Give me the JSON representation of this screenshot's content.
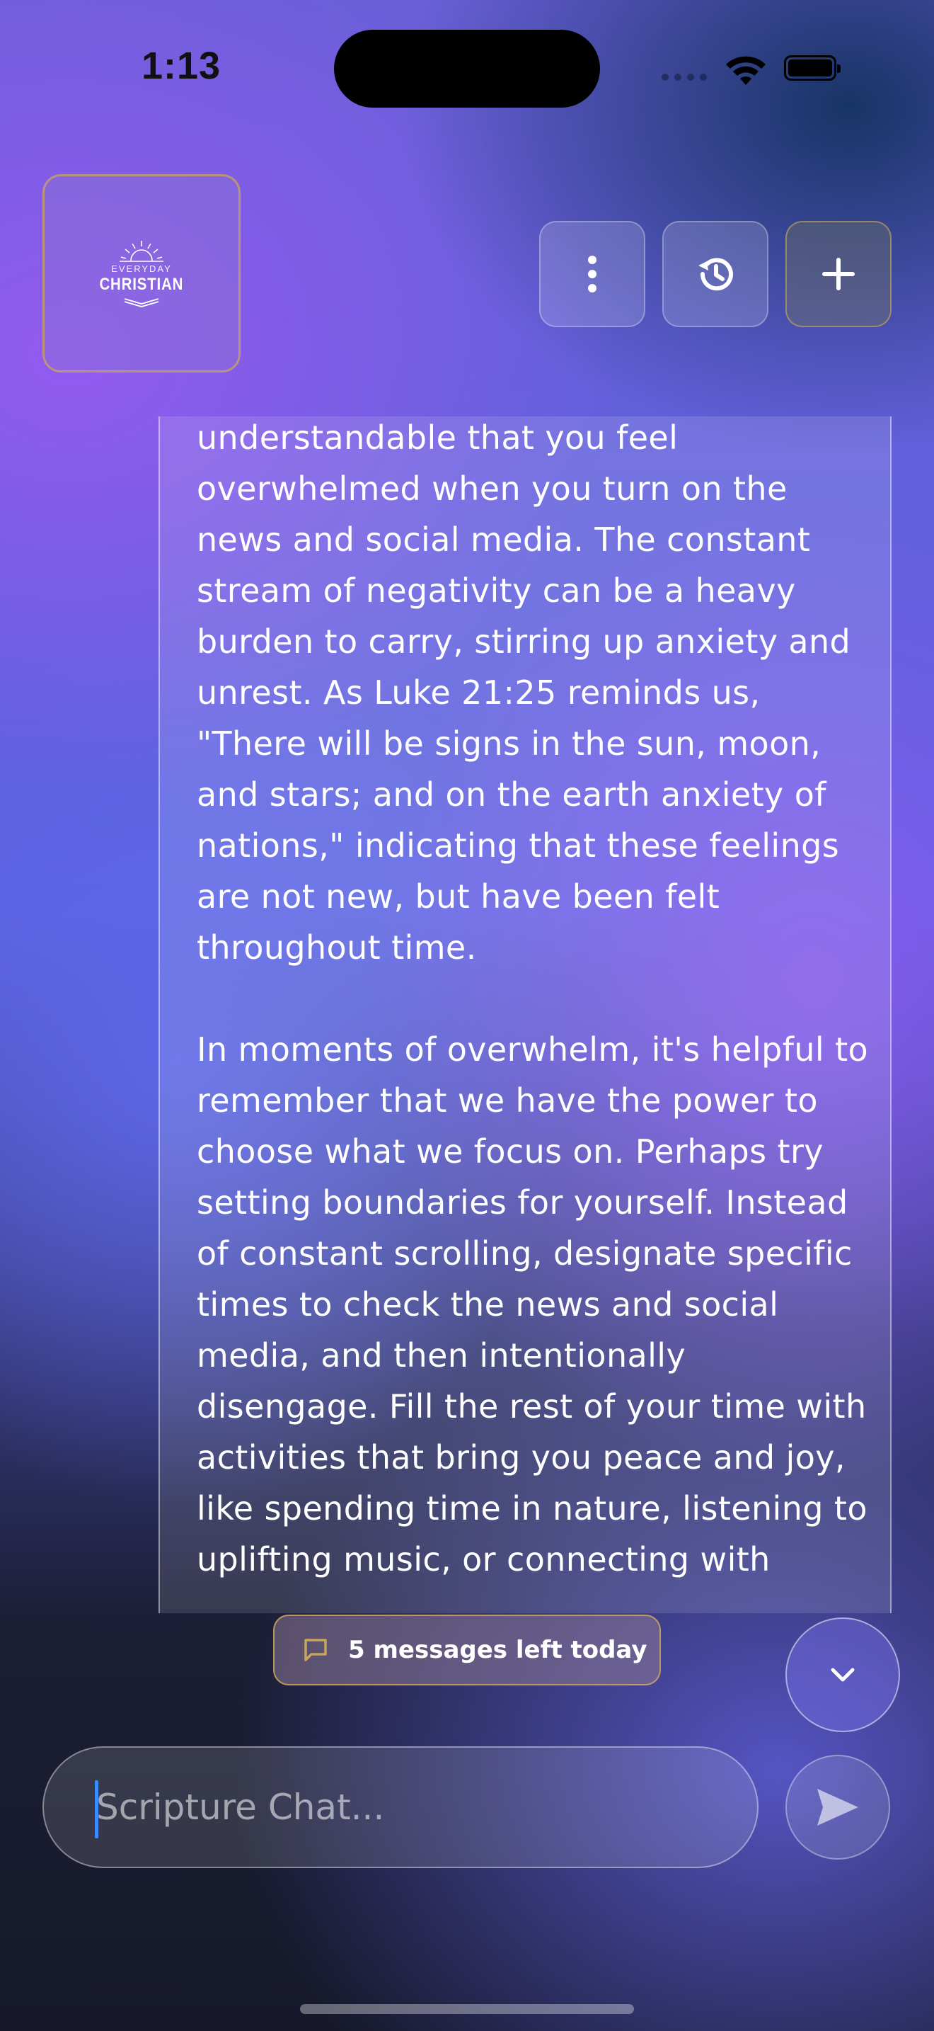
{
  "status_bar": {
    "time": "1:13"
  },
  "logo": {
    "line_small": "EVERYDAY",
    "line_big": "CHRISTIAN"
  },
  "header": {
    "menu_icon": "more-vertical-icon",
    "history_icon": "history-icon",
    "new_chat_icon": "plus-icon"
  },
  "message": {
    "paragraphs": [
      "understandable that you feel overwhelmed when you turn on the news and social media. The constant stream of negativity can be a heavy burden to carry, stirring up anxiety and unrest. As Luke 21:25 reminds us, \"There will be signs in the sun, moon, and stars; and on the earth anxiety of nations,\" indicating that these feelings are not new, but have been felt throughout time.",
      "In moments of overwhelm, it's helpful to remember that we have the power to choose what we focus on. Perhaps try setting boundaries for yourself. Instead of constant scrolling, designate specific times to check the news and social media, and then intentionally disengage. Fill the rest of your time with activities that bring you peace and joy, like spending time in nature, listening to uplifting music, or connecting with"
    ]
  },
  "limit": {
    "text": "5 messages left today",
    "icon": "message-square-icon"
  },
  "composer": {
    "placeholder": "Scripture Chat...",
    "value": "",
    "send_icon": "send-icon"
  },
  "colors": {
    "accent_gold": "#c8a55a",
    "caret": "#3c8cff"
  }
}
